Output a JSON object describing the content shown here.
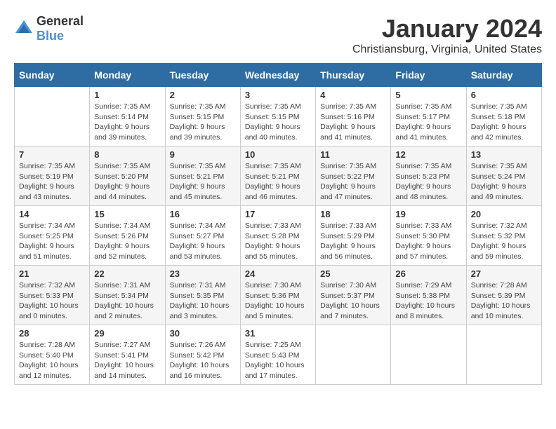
{
  "header": {
    "logo_general": "General",
    "logo_blue": "Blue",
    "title": "January 2024",
    "subtitle": "Christiansburg, Virginia, United States"
  },
  "calendar": {
    "days_of_week": [
      "Sunday",
      "Monday",
      "Tuesday",
      "Wednesday",
      "Thursday",
      "Friday",
      "Saturday"
    ],
    "weeks": [
      [
        {
          "day": "",
          "sunrise": "",
          "sunset": "",
          "daylight": ""
        },
        {
          "day": "1",
          "sunrise": "Sunrise: 7:35 AM",
          "sunset": "Sunset: 5:14 PM",
          "daylight": "Daylight: 9 hours and 39 minutes."
        },
        {
          "day": "2",
          "sunrise": "Sunrise: 7:35 AM",
          "sunset": "Sunset: 5:15 PM",
          "daylight": "Daylight: 9 hours and 39 minutes."
        },
        {
          "day": "3",
          "sunrise": "Sunrise: 7:35 AM",
          "sunset": "Sunset: 5:15 PM",
          "daylight": "Daylight: 9 hours and 40 minutes."
        },
        {
          "day": "4",
          "sunrise": "Sunrise: 7:35 AM",
          "sunset": "Sunset: 5:16 PM",
          "daylight": "Daylight: 9 hours and 41 minutes."
        },
        {
          "day": "5",
          "sunrise": "Sunrise: 7:35 AM",
          "sunset": "Sunset: 5:17 PM",
          "daylight": "Daylight: 9 hours and 41 minutes."
        },
        {
          "day": "6",
          "sunrise": "Sunrise: 7:35 AM",
          "sunset": "Sunset: 5:18 PM",
          "daylight": "Daylight: 9 hours and 42 minutes."
        }
      ],
      [
        {
          "day": "7",
          "sunrise": "Sunrise: 7:35 AM",
          "sunset": "Sunset: 5:19 PM",
          "daylight": "Daylight: 9 hours and 43 minutes."
        },
        {
          "day": "8",
          "sunrise": "Sunrise: 7:35 AM",
          "sunset": "Sunset: 5:20 PM",
          "daylight": "Daylight: 9 hours and 44 minutes."
        },
        {
          "day": "9",
          "sunrise": "Sunrise: 7:35 AM",
          "sunset": "Sunset: 5:21 PM",
          "daylight": "Daylight: 9 hours and 45 minutes."
        },
        {
          "day": "10",
          "sunrise": "Sunrise: 7:35 AM",
          "sunset": "Sunset: 5:21 PM",
          "daylight": "Daylight: 9 hours and 46 minutes."
        },
        {
          "day": "11",
          "sunrise": "Sunrise: 7:35 AM",
          "sunset": "Sunset: 5:22 PM",
          "daylight": "Daylight: 9 hours and 47 minutes."
        },
        {
          "day": "12",
          "sunrise": "Sunrise: 7:35 AM",
          "sunset": "Sunset: 5:23 PM",
          "daylight": "Daylight: 9 hours and 48 minutes."
        },
        {
          "day": "13",
          "sunrise": "Sunrise: 7:35 AM",
          "sunset": "Sunset: 5:24 PM",
          "daylight": "Daylight: 9 hours and 49 minutes."
        }
      ],
      [
        {
          "day": "14",
          "sunrise": "Sunrise: 7:34 AM",
          "sunset": "Sunset: 5:25 PM",
          "daylight": "Daylight: 9 hours and 51 minutes."
        },
        {
          "day": "15",
          "sunrise": "Sunrise: 7:34 AM",
          "sunset": "Sunset: 5:26 PM",
          "daylight": "Daylight: 9 hours and 52 minutes."
        },
        {
          "day": "16",
          "sunrise": "Sunrise: 7:34 AM",
          "sunset": "Sunset: 5:27 PM",
          "daylight": "Daylight: 9 hours and 53 minutes."
        },
        {
          "day": "17",
          "sunrise": "Sunrise: 7:33 AM",
          "sunset": "Sunset: 5:28 PM",
          "daylight": "Daylight: 9 hours and 55 minutes."
        },
        {
          "day": "18",
          "sunrise": "Sunrise: 7:33 AM",
          "sunset": "Sunset: 5:29 PM",
          "daylight": "Daylight: 9 hours and 56 minutes."
        },
        {
          "day": "19",
          "sunrise": "Sunrise: 7:33 AM",
          "sunset": "Sunset: 5:30 PM",
          "daylight": "Daylight: 9 hours and 57 minutes."
        },
        {
          "day": "20",
          "sunrise": "Sunrise: 7:32 AM",
          "sunset": "Sunset: 5:32 PM",
          "daylight": "Daylight: 9 hours and 59 minutes."
        }
      ],
      [
        {
          "day": "21",
          "sunrise": "Sunrise: 7:32 AM",
          "sunset": "Sunset: 5:33 PM",
          "daylight": "Daylight: 10 hours and 0 minutes."
        },
        {
          "day": "22",
          "sunrise": "Sunrise: 7:31 AM",
          "sunset": "Sunset: 5:34 PM",
          "daylight": "Daylight: 10 hours and 2 minutes."
        },
        {
          "day": "23",
          "sunrise": "Sunrise: 7:31 AM",
          "sunset": "Sunset: 5:35 PM",
          "daylight": "Daylight: 10 hours and 3 minutes."
        },
        {
          "day": "24",
          "sunrise": "Sunrise: 7:30 AM",
          "sunset": "Sunset: 5:36 PM",
          "daylight": "Daylight: 10 hours and 5 minutes."
        },
        {
          "day": "25",
          "sunrise": "Sunrise: 7:30 AM",
          "sunset": "Sunset: 5:37 PM",
          "daylight": "Daylight: 10 hours and 7 minutes."
        },
        {
          "day": "26",
          "sunrise": "Sunrise: 7:29 AM",
          "sunset": "Sunset: 5:38 PM",
          "daylight": "Daylight: 10 hours and 8 minutes."
        },
        {
          "day": "27",
          "sunrise": "Sunrise: 7:28 AM",
          "sunset": "Sunset: 5:39 PM",
          "daylight": "Daylight: 10 hours and 10 minutes."
        }
      ],
      [
        {
          "day": "28",
          "sunrise": "Sunrise: 7:28 AM",
          "sunset": "Sunset: 5:40 PM",
          "daylight": "Daylight: 10 hours and 12 minutes."
        },
        {
          "day": "29",
          "sunrise": "Sunrise: 7:27 AM",
          "sunset": "Sunset: 5:41 PM",
          "daylight": "Daylight: 10 hours and 14 minutes."
        },
        {
          "day": "30",
          "sunrise": "Sunrise: 7:26 AM",
          "sunset": "Sunset: 5:42 PM",
          "daylight": "Daylight: 10 hours and 16 minutes."
        },
        {
          "day": "31",
          "sunrise": "Sunrise: 7:25 AM",
          "sunset": "Sunset: 5:43 PM",
          "daylight": "Daylight: 10 hours and 17 minutes."
        },
        {
          "day": "",
          "sunrise": "",
          "sunset": "",
          "daylight": ""
        },
        {
          "day": "",
          "sunrise": "",
          "sunset": "",
          "daylight": ""
        },
        {
          "day": "",
          "sunrise": "",
          "sunset": "",
          "daylight": ""
        }
      ]
    ]
  }
}
